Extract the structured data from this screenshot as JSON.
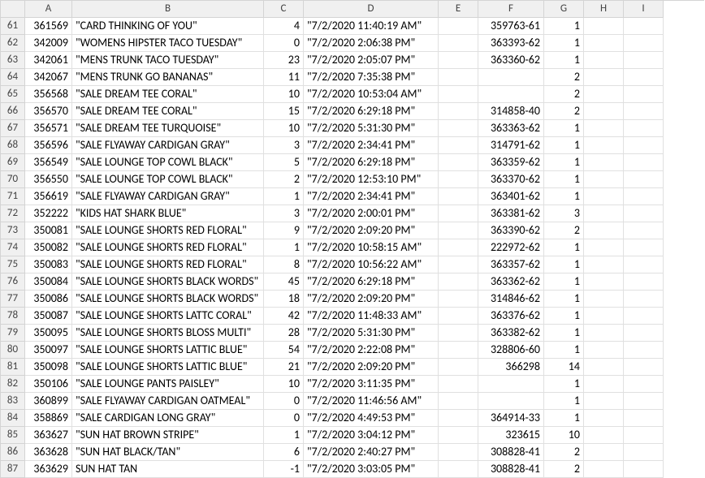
{
  "chart_data": {
    "type": "table",
    "columns": [
      "A",
      "B",
      "C",
      "D",
      "E",
      "F",
      "G",
      "H",
      "I"
    ],
    "row_start": 61,
    "rows": [
      {
        "A": 361569,
        "B": "\"CARD THINKING OF YOU\"",
        "C": 4,
        "D": "\"7/2/2020 11:40:19 AM\"",
        "E": "",
        "F": "359763-61",
        "G": 1,
        "H": "",
        "I": ""
      },
      {
        "A": 342009,
        "B": "\"WOMENS HIPSTER TACO TUESDAY\"",
        "C": 0,
        "D": "\"7/2/2020 2:06:38 PM\"",
        "E": "",
        "F": "363393-62",
        "G": 1,
        "H": "",
        "I": ""
      },
      {
        "A": 342061,
        "B": "\"MENS TRUNK TACO TUESDAY\"",
        "C": 23,
        "D": "\"7/2/2020 2:05:07 PM\"",
        "E": "",
        "F": "363360-62",
        "G": 1,
        "H": "",
        "I": ""
      },
      {
        "A": 342067,
        "B": "\"MENS TRUNK GO BANANAS\"",
        "C": 11,
        "D": "\"7/2/2020 7:35:38 PM\"",
        "E": "",
        "F": "",
        "G": 2,
        "H": "",
        "I": ""
      },
      {
        "A": 356568,
        "B": "\"SALE DREAM TEE CORAL\"",
        "C": 10,
        "D": "\"7/2/2020 10:53:04 AM\"",
        "E": "",
        "F": "",
        "G": 2,
        "H": "",
        "I": ""
      },
      {
        "A": 356570,
        "B": "\"SALE DREAM TEE CORAL\"",
        "C": 15,
        "D": "\"7/2/2020 6:29:18 PM\"",
        "E": "",
        "F": "314858-40",
        "G": 2,
        "H": "",
        "I": ""
      },
      {
        "A": 356571,
        "B": "\"SALE DREAM TEE TURQUOISE\"",
        "C": 10,
        "D": "\"7/2/2020 5:31:30 PM\"",
        "E": "",
        "F": "363363-62",
        "G": 1,
        "H": "",
        "I": ""
      },
      {
        "A": 356596,
        "B": "\"SALE FLYAWAY CARDIGAN GRAY\"",
        "C": 3,
        "D": "\"7/2/2020 2:34:41 PM\"",
        "E": "",
        "F": "314791-62",
        "G": 1,
        "H": "",
        "I": ""
      },
      {
        "A": 356549,
        "B": "\"SALE LOUNGE TOP COWL BLACK\"",
        "C": 5,
        "D": "\"7/2/2020 6:29:18 PM\"",
        "E": "",
        "F": "363359-62",
        "G": 1,
        "H": "",
        "I": ""
      },
      {
        "A": 356550,
        "B": "\"SALE LOUNGE TOP COWL BLACK\"",
        "C": 2,
        "D": "\"7/2/2020 12:53:10 PM\"",
        "E": "",
        "F": "363370-62",
        "G": 1,
        "H": "",
        "I": ""
      },
      {
        "A": 356619,
        "B": "\"SALE FLYAWAY CARDIGAN GRAY\"",
        "C": 1,
        "D": "\"7/2/2020 2:34:41 PM\"",
        "E": "",
        "F": "363401-62",
        "G": 1,
        "H": "",
        "I": ""
      },
      {
        "A": 352222,
        "B": "\"KIDS HAT SHARK BLUE\"",
        "C": 3,
        "D": "\"7/2/2020 2:00:01 PM\"",
        "E": "",
        "F": "363381-62",
        "G": 3,
        "H": "",
        "I": ""
      },
      {
        "A": 350081,
        "B": "\"SALE LOUNGE SHORTS RED FLORAL\"",
        "C": 9,
        "D": "\"7/2/2020 2:09:20 PM\"",
        "E": "",
        "F": "363390-62",
        "G": 2,
        "H": "",
        "I": ""
      },
      {
        "A": 350082,
        "B": "\"SALE LOUNGE SHORTS RED FLORAL\"",
        "C": 1,
        "D": "\"7/2/2020 10:58:15 AM\"",
        "E": "",
        "F": "222972-62",
        "G": 1,
        "H": "",
        "I": ""
      },
      {
        "A": 350083,
        "B": "\"SALE LOUNGE SHORTS RED FLORAL\"",
        "C": 8,
        "D": "\"7/2/2020 10:56:22 AM\"",
        "E": "",
        "F": "363357-62",
        "G": 1,
        "H": "",
        "I": ""
      },
      {
        "A": 350084,
        "B": "\"SALE LOUNGE SHORTS BLACK WORDS\"",
        "C": 45,
        "D": "\"7/2/2020 6:29:18 PM\"",
        "E": "",
        "F": "363362-62",
        "G": 1,
        "H": "",
        "I": ""
      },
      {
        "A": 350086,
        "B": "\"SALE LOUNGE SHORTS BLACK WORDS\"",
        "C": 18,
        "D": "\"7/2/2020 2:09:20 PM\"",
        "E": "",
        "F": "314846-62",
        "G": 1,
        "H": "",
        "I": ""
      },
      {
        "A": 350087,
        "B": "\"SALE LOUNGE SHORTS LATTC CORAL\"",
        "C": 42,
        "D": "\"7/2/2020 11:48:33 AM\"",
        "E": "",
        "F": "363376-62",
        "G": 1,
        "H": "",
        "I": ""
      },
      {
        "A": 350095,
        "B": "\"SALE LOUNGE SHORTS BLOSS MULTI\"",
        "C": 28,
        "D": "\"7/2/2020 5:31:30 PM\"",
        "E": "",
        "F": "363382-62",
        "G": 1,
        "H": "",
        "I": ""
      },
      {
        "A": 350097,
        "B": "\"SALE LOUNGE SHORTS LATTIC BLUE\"",
        "C": 54,
        "D": "\"7/2/2020 2:22:08 PM\"",
        "E": "",
        "F": "328806-60",
        "G": 1,
        "H": "",
        "I": ""
      },
      {
        "A": 350098,
        "B": "\"SALE LOUNGE SHORTS LATTIC BLUE\"",
        "C": 21,
        "D": "\"7/2/2020 2:09:20 PM\"",
        "E": "",
        "F": "366298",
        "G": 14,
        "H": "",
        "I": ""
      },
      {
        "A": 350106,
        "B": "\"SALE LOUNGE PANTS PAISLEY\"",
        "C": 10,
        "D": "\"7/2/2020 3:11:35 PM\"",
        "E": "",
        "F": "",
        "G": 1,
        "H": "",
        "I": ""
      },
      {
        "A": 360899,
        "B": "\"SALE FLYAWAY CARDIGAN OATMEAL\"",
        "C": 0,
        "D": "\"7/2/2020 11:46:56 AM\"",
        "E": "",
        "F": "",
        "G": 1,
        "H": "",
        "I": ""
      },
      {
        "A": 358869,
        "B": "\"SALE CARDIGAN LONG GRAY\"",
        "C": 0,
        "D": "\"7/2/2020 4:49:53 PM\"",
        "E": "",
        "F": "364914-33",
        "G": 1,
        "H": "",
        "I": ""
      },
      {
        "A": 363627,
        "B": "\"SUN HAT BROWN STRIPE\"",
        "C": 1,
        "D": "\"7/2/2020 3:04:12 PM\"",
        "E": "",
        "F": "323615",
        "G": 10,
        "H": "",
        "I": ""
      },
      {
        "A": 363628,
        "B": "\"SUN HAT BLACK/TAN\"",
        "C": 6,
        "D": "\"7/2/2020 2:40:27 PM\"",
        "E": "",
        "F": "308828-41",
        "G": 2,
        "H": "",
        "I": ""
      },
      {
        "A": 363629,
        "B": "SUN HAT TAN",
        "C": -1,
        "D": "\"7/2/2020 3:03:05 PM\"",
        "E": "",
        "F": "308828-41",
        "G": 2,
        "H": "",
        "I": ""
      }
    ]
  },
  "column_align": {
    "A": "tar",
    "B": "tal",
    "C": "tar",
    "D": "tal",
    "E": "tal",
    "F": "tar",
    "G": "tar",
    "H": "tal",
    "I": "tal"
  }
}
